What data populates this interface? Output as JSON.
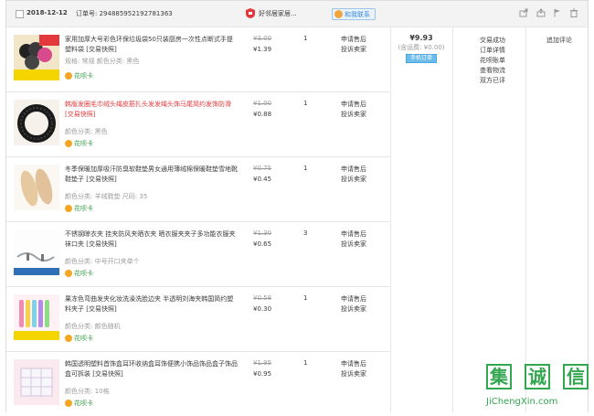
{
  "order": {
    "date": "2018-12-12",
    "order_label": "订单号: 294885952192781363",
    "shop_name": "好邻居家居...",
    "wangwang_label": "和我联系",
    "total_price": "¥9.93",
    "shipping": "(含运费: ¥0.00)",
    "pay_method": "手机订单",
    "status_items": [
      "交易成功",
      "订单详情",
      "花呗账单",
      "查看物流",
      "双方已评"
    ],
    "eval_label": "追加评论"
  },
  "items": [
    {
      "name": "家用加厚大号彩色环保垃圾袋50只装厨房一次性点断式手提塑料袋 [交易快照]",
      "name_color": "normal",
      "attr": "规格: 常规   颜色分类: 黑色",
      "badge": "花呗卡",
      "orig_price": "¥3.00",
      "price": "¥1.39",
      "qty": "1",
      "service": [
        "申请售后",
        "投诉卖家"
      ]
    },
    {
      "name": "韩版发圈毛巾绒头绳皮筋扎头发发绳头饰马尾简约发饰防滑 [交易快照]",
      "name_color": "red",
      "attr": "颜色分类: 黑色",
      "badge": "花呗卡",
      "orig_price": "¥1.00",
      "price": "¥0.88",
      "qty": "1",
      "service": [
        "申请售后",
        "投诉卖家"
      ]
    },
    {
      "name": "冬季保暖加厚吸汗防臭软鞋垫男女通用薄绒棉保暖鞋垫雪地靴鞋垫子 [交易快照]",
      "name_color": "normal",
      "attr": "颜色分类: 羊绒鞋垫   尺码: 35",
      "badge": "花呗卡",
      "orig_price": "¥0.75",
      "price": "¥0.45",
      "qty": "1",
      "service": [
        "申请售后",
        "投诉卖家"
      ]
    },
    {
      "name": "不锈钢晾衣夹 挂夹防风夹晒衣夹 晒衣服夹夹子多功能衣服夹袜口夹 [交易快照]",
      "name_color": "normal",
      "attr": "颜色分类: 中号开口夹单个",
      "badge": "花呗卡",
      "orig_price": "¥1.30",
      "price": "¥0.65",
      "qty": "3",
      "service": [
        "申请售后",
        "投诉卖家"
      ]
    },
    {
      "name": "果冻色弯曲发夹化妆洗澡洗脸边夹 半透明刘海夹韩国简约塑料夹子 [交易快照]",
      "name_color": "normal",
      "attr": "颜色分类: 颜色随机",
      "badge": "花呗卡",
      "orig_price": "¥0.58",
      "price": "¥0.30",
      "qty": "1",
      "service": [
        "申请售后",
        "投诉卖家"
      ]
    },
    {
      "name": "韩国透明塑料首饰盒耳环收纳盒耳饰便携小饰品饰品盒子饰品盒可拆装 [交易快照]",
      "name_color": "normal",
      "attr": "颜色分类: 10格",
      "badge": "花呗卡",
      "orig_price": "¥1.95",
      "price": "¥0.95",
      "qty": "1",
      "service": [
        "申请售后",
        "投诉卖家"
      ]
    }
  ],
  "watermark": {
    "chars": [
      "集",
      "诚",
      "信"
    ],
    "url": "JiChengXin.com"
  },
  "colors": {
    "accent_blue": "#3a8ad6",
    "red": "#e4393c",
    "green": "#33a650"
  }
}
